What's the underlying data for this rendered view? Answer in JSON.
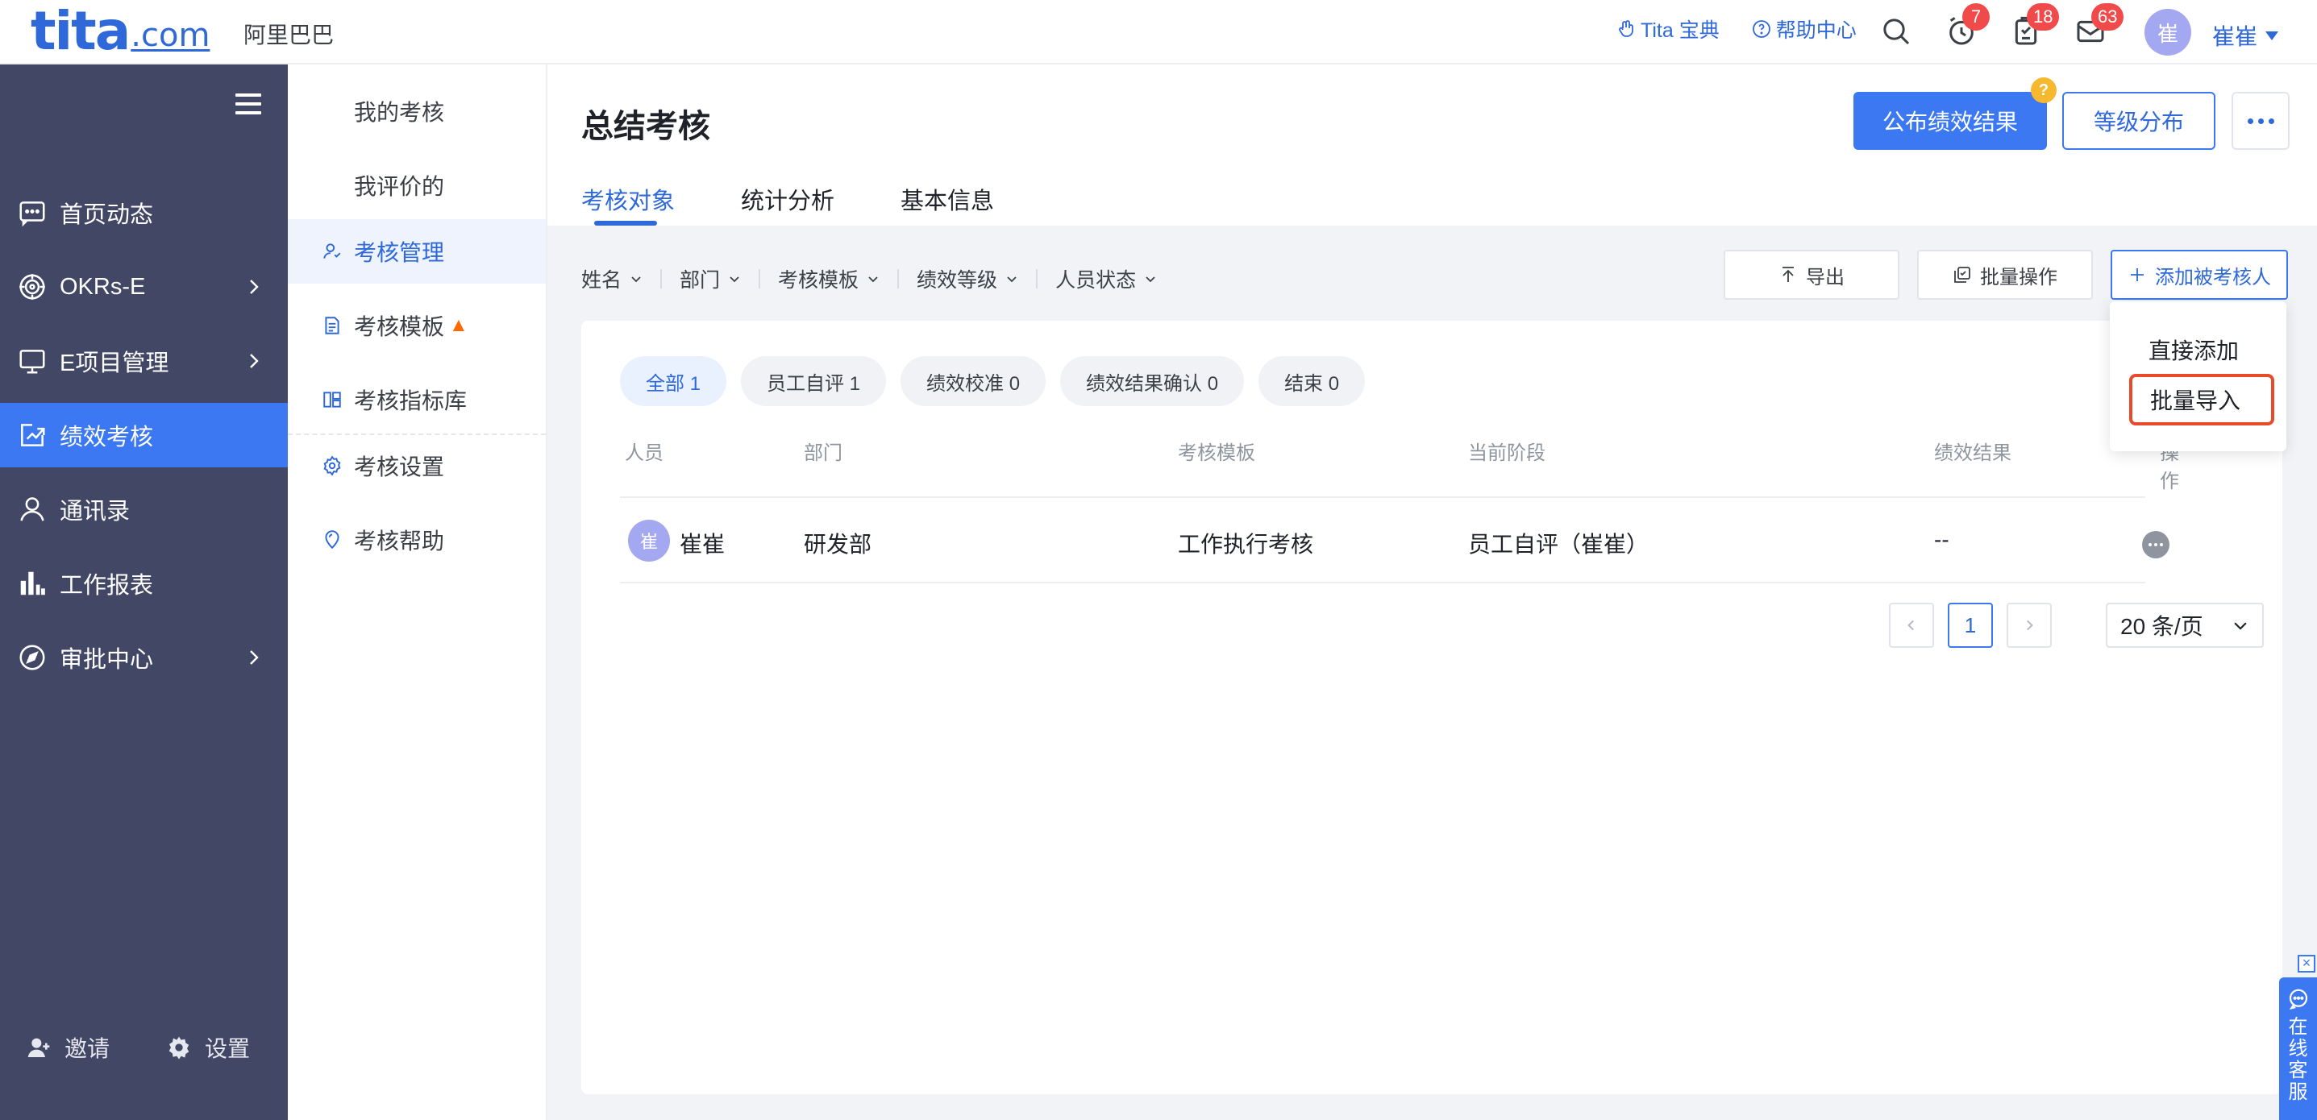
{
  "header": {
    "logo_main": "tita",
    "logo_suffix": ".com",
    "company": "阿里巴巴",
    "links": [
      {
        "label": "Tita 宝典",
        "icon": "hand-icon"
      },
      {
        "label": "帮助中心",
        "icon": "question-circle-icon"
      }
    ],
    "notifications": {
      "clock": "7",
      "tasks": "18",
      "messages": "63"
    },
    "user": {
      "avatar_text": "崔",
      "name": "崔崔"
    }
  },
  "sidebar": {
    "items": [
      {
        "label": "首页动态",
        "icon": "chat-icon"
      },
      {
        "label": "OKRs-E",
        "icon": "target-icon",
        "has_children": true
      },
      {
        "label": "E项目管理",
        "icon": "monitor-icon",
        "has_children": true
      },
      {
        "label": "绩效考核",
        "icon": "trend-icon",
        "active": true
      },
      {
        "label": "通讯录",
        "icon": "person-icon"
      },
      {
        "label": "工作报表",
        "icon": "bar-chart-icon"
      },
      {
        "label": "审批中心",
        "icon": "compass-icon",
        "has_children": true
      }
    ],
    "bottom": {
      "invite": "邀请",
      "settings": "设置"
    }
  },
  "submenu": {
    "items": [
      {
        "label": "我的考核"
      },
      {
        "label": "我评价的"
      },
      {
        "label": "考核管理",
        "active": true
      },
      {
        "label": "考核模板"
      },
      {
        "label": "考核指标库"
      },
      {
        "label": "考核设置"
      },
      {
        "label": "考核帮助"
      }
    ]
  },
  "main": {
    "title": "总结考核",
    "publish_button": "公布绩效结果",
    "help_badge": "?",
    "grade_button": "等级分布",
    "tabs": [
      "考核对象",
      "统计分析",
      "基本信息"
    ],
    "filters": [
      "姓名",
      "部门",
      "考核模板",
      "绩效等级",
      "人员状态"
    ],
    "export_button": "导出",
    "batch_button": "批量操作",
    "add_button": "添加被考核人",
    "status_chips": [
      "全部 1",
      "员工自评 1",
      "绩效校准 0",
      "绩效结果确认 0",
      "结束 0"
    ],
    "table": {
      "columns": [
        "人员",
        "部门",
        "考核模板",
        "当前阶段",
        "绩效结果",
        "操作"
      ],
      "rows": [
        {
          "avatar": "崔",
          "name": "崔崔",
          "dept": "研发部",
          "template": "工作执行考核",
          "stage": "员工自评（崔崔）",
          "result": "--"
        }
      ]
    },
    "pagination": {
      "current": "1",
      "page_size": "20 条/页"
    },
    "add_dropdown": [
      "直接添加",
      "批量导入"
    ]
  },
  "service": {
    "label": [
      "在",
      "线",
      "客",
      "服"
    ],
    "close": "×"
  }
}
